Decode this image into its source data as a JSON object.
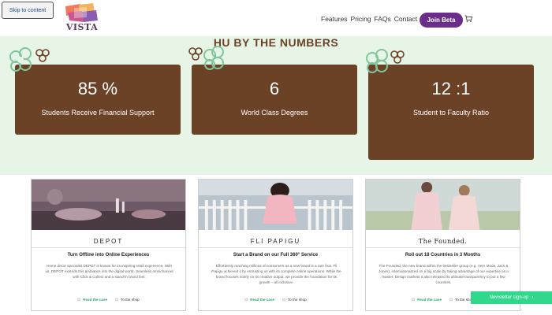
{
  "header": {
    "skip_link": "Skip to content",
    "logo_text": "VISTA",
    "nav": [
      "Features",
      "Pricing",
      "FAQs",
      "Contact"
    ],
    "join_button": "Join Beta",
    "cart_icon": "cart-icon"
  },
  "stats": {
    "title": "HU BY THE NUMBERS",
    "items": [
      {
        "value": "85 %",
        "label": "Students Receive Financial Support"
      },
      {
        "value": "6",
        "label": "World Class Degrees"
      },
      {
        "value": "12 :1",
        "label": "Student to Faculty Ratio"
      }
    ],
    "accent": "#6b4226",
    "background": "#e7f5e7"
  },
  "cases": [
    {
      "brand": "DEPOT",
      "headline": "Turn Offline into Online Experiences",
      "description": "Home decor specialist DEPOT is known for its inspiring retail experience. With us, DEPOT extends this ambiance into the digital world. Seamless omnichannel with Click & Collect and a stand-in brand feel.",
      "read_case": "Read the case",
      "to_shop": "To the shop"
    },
    {
      "brand": "FLI PAPIGU",
      "headline": "Start a Brand on our Full 360° Service",
      "description": "Effortlessly reaching millions of consumers as a new brand is a rare feat. Fli Papigu achieved it by entrusting us with its complete online operations. While the brand focuses solely on its creative output, we provide the foundation for its growth – all inclusive.",
      "read_case": "Read the case",
      "to_shop": "To the shop"
    },
    {
      "brand": "The Founded.",
      "headline": "Roll out 18 Countries in 3 Months",
      "description": "The Founded, the new brand within the bestseller group (e.g. Vero Moda, Jack & Jones), internationalized on a big scale by taking advantage of our expertise as a master. Design markets it also released its ultimate transparency to put a few countries.",
      "read_case": "Read the case",
      "to_shop": "To the shop"
    }
  ],
  "newsletter": "Newsletter sign-up"
}
